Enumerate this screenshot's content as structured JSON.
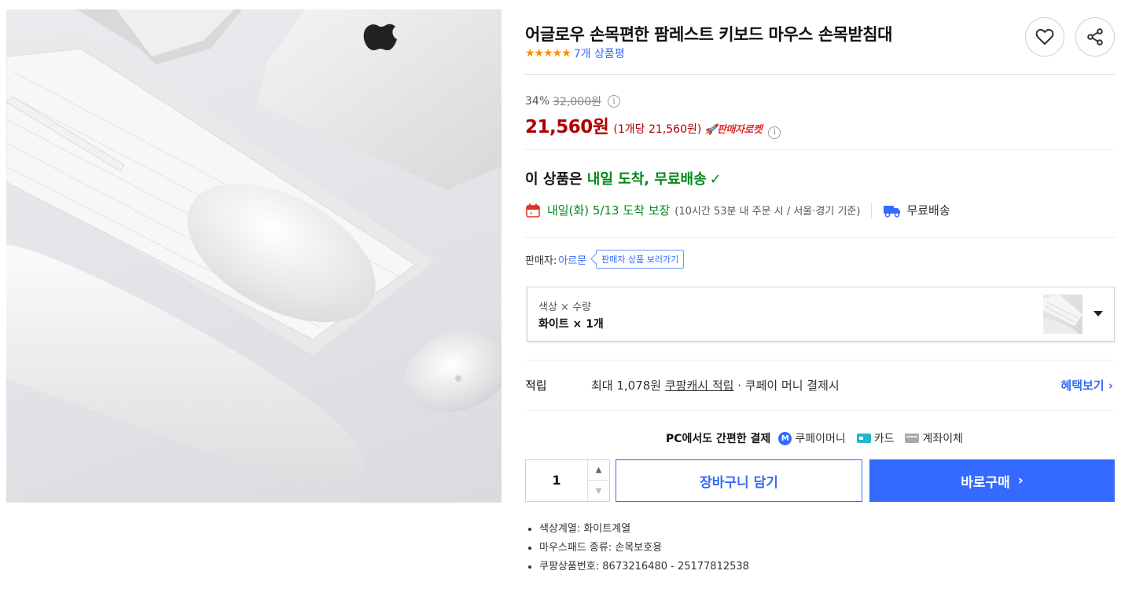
{
  "product": {
    "title": "어글로우 손목편한 팜레스트 키보드 마우스 손목받침대",
    "rating_stars": "★★★★★",
    "review_count": "7개 상품평",
    "rating": 5
  },
  "price": {
    "discount_rate": "34%",
    "original_price": "32,000원",
    "sale_price": "21,560원",
    "unit_price": "(1개당 21,560원)",
    "badge": "🚀판매자로켓"
  },
  "delivery": {
    "headline_prefix": "이 상품은 ",
    "headline_green": "내일 도착, 무료배송",
    "headline_check": "✓",
    "guarantee": "내일(화) 5/13 도착 보장",
    "note": "(10시간 53분  내 주문 시 / 서울·경기 기준)",
    "free_shipping": "무료배송"
  },
  "seller": {
    "label": "판매자:",
    "name": "아르문",
    "view_products": "판매자 상품 보러가기"
  },
  "option": {
    "label": "색상 × 수량",
    "value": "화이트 × 1개"
  },
  "cash": {
    "label": "적립",
    "text_before": "최대 1,078원 ",
    "text_underlined": "쿠팡캐시 적립",
    "text_after": " · 쿠페이 머니 결제시",
    "benefit_link": "혜택보기 ›"
  },
  "payment": {
    "title": "PC에서도 간편한 결제",
    "methods": [
      {
        "badge": "M",
        "label": "쿠페이머니"
      },
      {
        "label": "카드"
      },
      {
        "label": "계좌이체"
      }
    ]
  },
  "purchase": {
    "quantity": "1",
    "cart_label": "장바구니 담기",
    "buy_label": "바로구매",
    "buy_chevron": "›"
  },
  "attributes": [
    "색상계열: 화이트계열",
    "마우스패드 종류: 손목보호용",
    "쿠팡상품번호: 8673216480 - 25177812538"
  ],
  "colors": {
    "accent": "#346aff",
    "price": "#ae0000",
    "green": "#00891a",
    "stars": "#ff8c00"
  }
}
